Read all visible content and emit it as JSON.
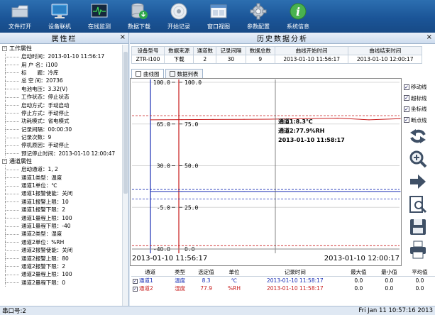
{
  "toolbar": {
    "buttons": [
      {
        "label": "文件打开",
        "icon": "folder-icon"
      },
      {
        "label": "设备联机",
        "icon": "monitor-icon"
      },
      {
        "label": "在线监测",
        "icon": "ecg-monitor-icon"
      },
      {
        "label": "数据下载",
        "icon": "database-download-icon"
      },
      {
        "label": "开始记录",
        "icon": "disc-icon"
      },
      {
        "label": "窗口视图",
        "icon": "window-icon"
      },
      {
        "label": "参数配置",
        "icon": "gear-icon"
      },
      {
        "label": "系统信息",
        "icon": "info-icon"
      }
    ]
  },
  "left_panel": {
    "title": "属性栏",
    "close": "×",
    "groups": [
      {
        "toggle": "-",
        "label": "工作属性",
        "items": [
          "启动时间：2013-01-10 11:56:17",
          "用 户 名：i100",
          "标　　题：冷库",
          "总 空 间：20736",
          "电池电压：3.32(V)",
          "工作状态：停止状态",
          "启动方式：手动启动",
          "停止方式：手动停止",
          "功耗模式：省电模式",
          "记录间隔：00:00:30",
          "记录次数：9",
          "停机原因：手动停止",
          "预记停止时间：2013-01-10 12:00:47"
        ]
      },
      {
        "toggle": "-",
        "label": "通道属性",
        "items": [
          "启动通道：1, 2",
          "通道1类型：温度",
          "通道1单位：℃",
          "通道1报警使能：关闭",
          "通道1报警上限：10",
          "通道1报警下限：2",
          "通道1量程上限：100",
          "通道1量程下限：-40",
          "通道2类型：湿度",
          "通道2单位：%RH",
          "通道2报警使能：关闭",
          "通道2报警上限：80",
          "通道2报警下限：2",
          "通道2量程上限：100",
          "通道2量程下限：0"
        ]
      }
    ]
  },
  "right_panel": {
    "title": "历史数据分析",
    "close": "×",
    "summary": {
      "headers": [
        "设备型号",
        "数据来源",
        "通道数",
        "记录间隔",
        "数据总数",
        "曲线开始时间",
        "曲线结束时间"
      ],
      "row": [
        "ZTR-i100",
        "下载",
        "2",
        "30",
        "9",
        "2013-01-10 11:56:17",
        "2013-01-10 12:00:17"
      ]
    },
    "tabs": [
      {
        "label": "曲线图",
        "icon": "chart-tab-icon"
      },
      {
        "label": "数据列表",
        "icon": "list-tab-icon"
      }
    ],
    "options": [
      {
        "label": "移动线",
        "checked": true
      },
      {
        "label": "超标线",
        "checked": true
      },
      {
        "label": "坐标线",
        "checked": true
      },
      {
        "label": "断点线",
        "checked": true
      }
    ],
    "tools": [
      "rotate-icon",
      "zoom-in-icon",
      "arrow-right-icon",
      "zoom-page-icon",
      "save-icon",
      "print-icon"
    ]
  },
  "chart_data": {
    "type": "line",
    "axes": [
      {
        "name": "通道1",
        "ticks": [
          "100.0",
          "65.0",
          "30.0",
          "-5.0",
          "-40.0"
        ],
        "ylim": [
          -40,
          100
        ],
        "color": "#1a2fb5"
      },
      {
        "name": "通道2",
        "ticks": [
          "100.0",
          "75.0",
          "50.0",
          "25.0",
          "0.0"
        ],
        "ylim": [
          0,
          100
        ],
        "color": "#c81c1c"
      }
    ],
    "x_start": "2013-01-10 11:56:17",
    "x_end": "2013-01-10 12:00:17",
    "series": [
      {
        "name": "通道1",
        "color": "#1a2fb5",
        "x": [
          "11:56:17",
          "11:56:47",
          "11:57:17",
          "11:57:47",
          "11:58:17",
          "11:58:47",
          "11:59:17",
          "11:59:47",
          "12:00:17"
        ],
        "values": [
          8.3,
          8.3,
          8.3,
          8.3,
          8.3,
          8.3,
          8.3,
          8.3,
          8.3
        ]
      },
      {
        "name": "通道2",
        "color": "#c81c1c",
        "x": [
          "11:56:17",
          "11:56:47",
          "11:57:17",
          "11:57:47",
          "11:58:17",
          "11:58:47",
          "11:59:17",
          "11:59:47",
          "12:00:17"
        ],
        "values": [
          77.5,
          77.6,
          77.7,
          77.8,
          77.9,
          78.2,
          78.5,
          77.5,
          78.2
        ]
      }
    ],
    "alarm_lines": [
      {
        "series": "通道1",
        "value": 10,
        "color": "#1a2fb5"
      },
      {
        "series": "通道1",
        "value": 2,
        "color": "#1a2fb5"
      },
      {
        "series": "通道2",
        "value": 80,
        "color": "#c81c1c"
      },
      {
        "series": "通道2",
        "value": 2,
        "color": "#c81c1c"
      }
    ],
    "cursor": {
      "x": "11:58:17",
      "text": [
        "通道1:8.3℃",
        "通道2:77.9%RH",
        "2013-01-10 11:58:17"
      ]
    },
    "grid": true
  },
  "channel_table": {
    "headers": [
      "通道",
      "类型",
      "选定值",
      "单位",
      "记录时间",
      "最大值",
      "最小值",
      "平均值"
    ],
    "rows": [
      {
        "name": "通道1",
        "type": "温度",
        "value": "8.3",
        "unit": "℃",
        "time": "2013-01-10 11:58:17",
        "max": "0.0",
        "min": "0.0",
        "avg": "0.0",
        "color": "#1a2fb5"
      },
      {
        "name": "通道2",
        "type": "湿度",
        "value": "77.9",
        "unit": "%RH",
        "time": "2013-01-10 11:58:17",
        "max": "0.0",
        "min": "0.0",
        "avg": "0.0",
        "color": "#c81c1c"
      }
    ]
  },
  "statusbar": {
    "left": "串口号:2",
    "right": "Fri Jan 11 10:57:16 2013"
  }
}
